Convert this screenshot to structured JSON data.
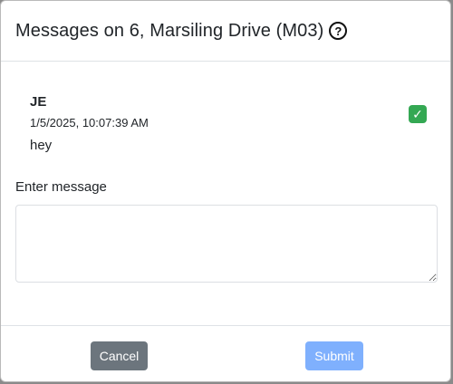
{
  "modal": {
    "title": "Messages on 6, Marsiling Drive (M03)",
    "help_icon": "question-circle-icon"
  },
  "messages": [
    {
      "author": "JE",
      "timestamp": "1/5/2025, 10:07:39 AM",
      "text": "hey",
      "status_icon": "check-mark-icon",
      "status_color": "#34a853"
    }
  ],
  "form": {
    "label": "Enter message",
    "value": "",
    "placeholder": ""
  },
  "footer": {
    "cancel_label": "Cancel",
    "submit_label": "Submit"
  },
  "colors": {
    "cancel": "#6c757d",
    "submit": "#7fb0fd"
  }
}
